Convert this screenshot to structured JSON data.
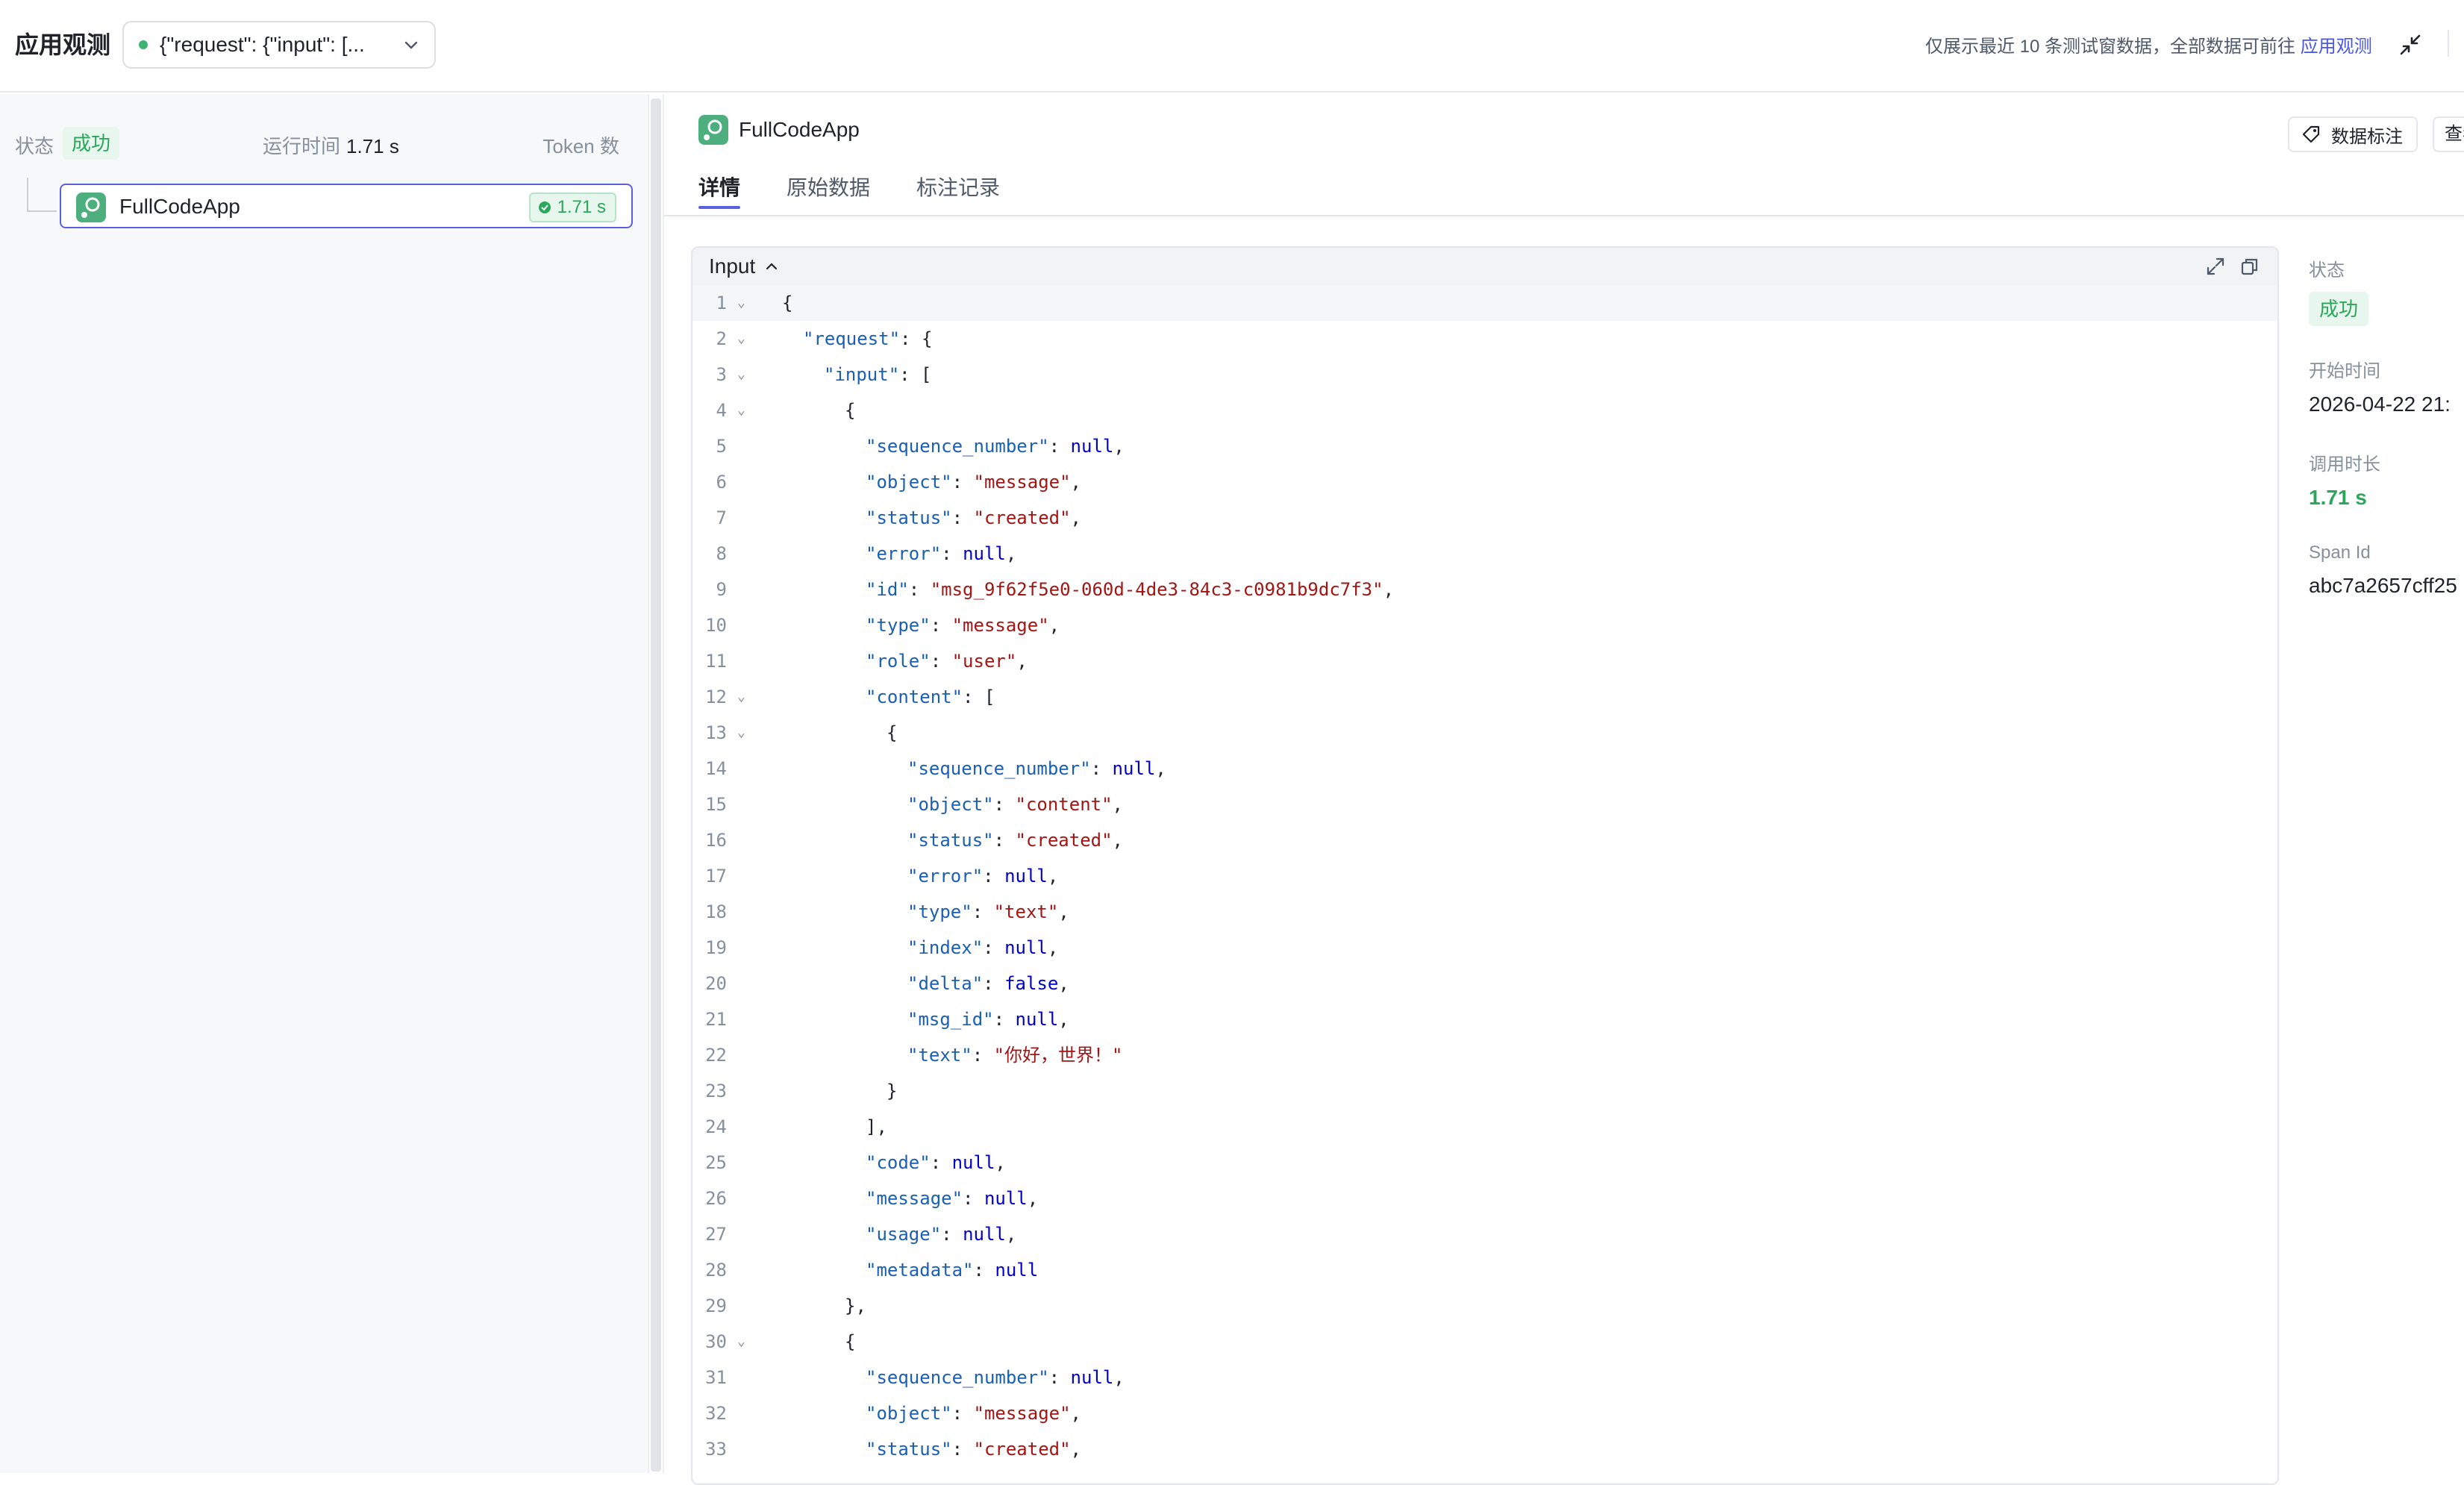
{
  "header": {
    "app_title": "应用观测",
    "request_select": "{\"request\": {\"input\": [...",
    "notice_text": "仅展示最近 10 条测试窗数据，全部数据可前往 ",
    "notice_link": "应用观测"
  },
  "left": {
    "status_label": "状态",
    "status_value": "成功",
    "runtime_label": "运行时间",
    "runtime_value": "1.71 s",
    "token_label": "Token 数",
    "node": {
      "name": "FullCodeApp",
      "time": "1.71 s",
      "icon": "app-icon"
    }
  },
  "right": {
    "span_name": "FullCodeApp",
    "tag_button": "数据标注",
    "view_button": "查看",
    "tabs": [
      "详情",
      "原始数据",
      "标注记录"
    ],
    "code_panel_title": "Input",
    "meta": {
      "status_label": "状态",
      "status_value": "成功",
      "start_label": "开始时间",
      "start_value": "2026-04-22 21:",
      "duration_label": "调用时长",
      "duration_value": "1.71 s",
      "span_id_label": "Span Id",
      "span_id_value": "abc7a2657cff25"
    }
  },
  "code_lines": [
    {
      "n": "1",
      "fold": true,
      "indent": 0,
      "parts": [
        [
          "p",
          "{"
        ]
      ]
    },
    {
      "n": "2",
      "fold": true,
      "indent": 1,
      "parts": [
        [
          "k",
          "\"request\""
        ],
        [
          "p",
          ": {"
        ]
      ]
    },
    {
      "n": "3",
      "fold": true,
      "indent": 2,
      "parts": [
        [
          "k",
          "\"input\""
        ],
        [
          "p",
          ": ["
        ]
      ]
    },
    {
      "n": "4",
      "fold": true,
      "indent": 3,
      "parts": [
        [
          "p",
          "{"
        ]
      ]
    },
    {
      "n": "5",
      "fold": false,
      "indent": 4,
      "parts": [
        [
          "k",
          "\"sequence_number\""
        ],
        [
          "p",
          ": "
        ],
        [
          "n",
          "null"
        ],
        [
          "p",
          ","
        ]
      ]
    },
    {
      "n": "6",
      "fold": false,
      "indent": 4,
      "parts": [
        [
          "k",
          "\"object\""
        ],
        [
          "p",
          ": "
        ],
        [
          "s",
          "\"message\""
        ],
        [
          "p",
          ","
        ]
      ]
    },
    {
      "n": "7",
      "fold": false,
      "indent": 4,
      "parts": [
        [
          "k",
          "\"status\""
        ],
        [
          "p",
          ": "
        ],
        [
          "s",
          "\"created\""
        ],
        [
          "p",
          ","
        ]
      ]
    },
    {
      "n": "8",
      "fold": false,
      "indent": 4,
      "parts": [
        [
          "k",
          "\"error\""
        ],
        [
          "p",
          ": "
        ],
        [
          "n",
          "null"
        ],
        [
          "p",
          ","
        ]
      ]
    },
    {
      "n": "9",
      "fold": false,
      "indent": 4,
      "parts": [
        [
          "k",
          "\"id\""
        ],
        [
          "p",
          ": "
        ],
        [
          "s",
          "\"msg_9f62f5e0-060d-4de3-84c3-c0981b9dc7f3\""
        ],
        [
          "p",
          ","
        ]
      ]
    },
    {
      "n": "10",
      "fold": false,
      "indent": 4,
      "parts": [
        [
          "k",
          "\"type\""
        ],
        [
          "p",
          ": "
        ],
        [
          "s",
          "\"message\""
        ],
        [
          "p",
          ","
        ]
      ]
    },
    {
      "n": "11",
      "fold": false,
      "indent": 4,
      "parts": [
        [
          "k",
          "\"role\""
        ],
        [
          "p",
          ": "
        ],
        [
          "s",
          "\"user\""
        ],
        [
          "p",
          ","
        ]
      ]
    },
    {
      "n": "12",
      "fold": true,
      "indent": 4,
      "parts": [
        [
          "k",
          "\"content\""
        ],
        [
          "p",
          ": ["
        ]
      ]
    },
    {
      "n": "13",
      "fold": true,
      "indent": 5,
      "parts": [
        [
          "p",
          "{"
        ]
      ]
    },
    {
      "n": "14",
      "fold": false,
      "indent": 6,
      "parts": [
        [
          "k",
          "\"sequence_number\""
        ],
        [
          "p",
          ": "
        ],
        [
          "n",
          "null"
        ],
        [
          "p",
          ","
        ]
      ]
    },
    {
      "n": "15",
      "fold": false,
      "indent": 6,
      "parts": [
        [
          "k",
          "\"object\""
        ],
        [
          "p",
          ": "
        ],
        [
          "s",
          "\"content\""
        ],
        [
          "p",
          ","
        ]
      ]
    },
    {
      "n": "16",
      "fold": false,
      "indent": 6,
      "parts": [
        [
          "k",
          "\"status\""
        ],
        [
          "p",
          ": "
        ],
        [
          "s",
          "\"created\""
        ],
        [
          "p",
          ","
        ]
      ]
    },
    {
      "n": "17",
      "fold": false,
      "indent": 6,
      "parts": [
        [
          "k",
          "\"error\""
        ],
        [
          "p",
          ": "
        ],
        [
          "n",
          "null"
        ],
        [
          "p",
          ","
        ]
      ]
    },
    {
      "n": "18",
      "fold": false,
      "indent": 6,
      "parts": [
        [
          "k",
          "\"type\""
        ],
        [
          "p",
          ": "
        ],
        [
          "s",
          "\"text\""
        ],
        [
          "p",
          ","
        ]
      ]
    },
    {
      "n": "19",
      "fold": false,
      "indent": 6,
      "parts": [
        [
          "k",
          "\"index\""
        ],
        [
          "p",
          ": "
        ],
        [
          "n",
          "null"
        ],
        [
          "p",
          ","
        ]
      ]
    },
    {
      "n": "20",
      "fold": false,
      "indent": 6,
      "parts": [
        [
          "k",
          "\"delta\""
        ],
        [
          "p",
          ": "
        ],
        [
          "n",
          "false"
        ],
        [
          "p",
          ","
        ]
      ]
    },
    {
      "n": "21",
      "fold": false,
      "indent": 6,
      "parts": [
        [
          "k",
          "\"msg_id\""
        ],
        [
          "p",
          ": "
        ],
        [
          "n",
          "null"
        ],
        [
          "p",
          ","
        ]
      ]
    },
    {
      "n": "22",
      "fold": false,
      "indent": 6,
      "parts": [
        [
          "k",
          "\"text\""
        ],
        [
          "p",
          ": "
        ],
        [
          "s",
          "\"你好，世界！\""
        ]
      ]
    },
    {
      "n": "23",
      "fold": false,
      "indent": 5,
      "parts": [
        [
          "p",
          "}"
        ]
      ]
    },
    {
      "n": "24",
      "fold": false,
      "indent": 4,
      "parts": [
        [
          "p",
          "],"
        ]
      ]
    },
    {
      "n": "25",
      "fold": false,
      "indent": 4,
      "parts": [
        [
          "k",
          "\"code\""
        ],
        [
          "p",
          ": "
        ],
        [
          "n",
          "null"
        ],
        [
          "p",
          ","
        ]
      ]
    },
    {
      "n": "26",
      "fold": false,
      "indent": 4,
      "parts": [
        [
          "k",
          "\"message\""
        ],
        [
          "p",
          ": "
        ],
        [
          "n",
          "null"
        ],
        [
          "p",
          ","
        ]
      ]
    },
    {
      "n": "27",
      "fold": false,
      "indent": 4,
      "parts": [
        [
          "k",
          "\"usage\""
        ],
        [
          "p",
          ": "
        ],
        [
          "n",
          "null"
        ],
        [
          "p",
          ","
        ]
      ]
    },
    {
      "n": "28",
      "fold": false,
      "indent": 4,
      "parts": [
        [
          "k",
          "\"metadata\""
        ],
        [
          "p",
          ": "
        ],
        [
          "n",
          "null"
        ]
      ]
    },
    {
      "n": "29",
      "fold": false,
      "indent": 3,
      "parts": [
        [
          "p",
          "},"
        ]
      ]
    },
    {
      "n": "30",
      "fold": true,
      "indent": 3,
      "parts": [
        [
          "p",
          "{"
        ]
      ]
    },
    {
      "n": "31",
      "fold": false,
      "indent": 4,
      "parts": [
        [
          "k",
          "\"sequence_number\""
        ],
        [
          "p",
          ": "
        ],
        [
          "n",
          "null"
        ],
        [
          "p",
          ","
        ]
      ]
    },
    {
      "n": "32",
      "fold": false,
      "indent": 4,
      "parts": [
        [
          "k",
          "\"object\""
        ],
        [
          "p",
          ": "
        ],
        [
          "s",
          "\"message\""
        ],
        [
          "p",
          ","
        ]
      ]
    },
    {
      "n": "33",
      "fold": false,
      "indent": 4,
      "parts": [
        [
          "k",
          "\"status\""
        ],
        [
          "p",
          ": "
        ],
        [
          "s",
          "\"created\""
        ],
        [
          "p",
          ","
        ]
      ]
    }
  ]
}
